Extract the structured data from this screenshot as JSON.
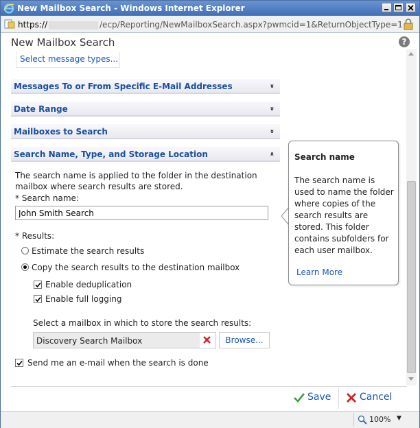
{
  "window": {
    "title": "New Mailbox Search - Windows Internet Explorer"
  },
  "address": {
    "protocol": "https://",
    "path": "/ecp/Reporting/NewMailboxSearch.aspx?pwmcid=1&ReturnObjectType=1"
  },
  "page": {
    "title": "New Mailbox Search",
    "help_icon": "?",
    "select_message_types": "Select message types..."
  },
  "sections": [
    {
      "label": "Messages To or From Specific E-Mail Addresses",
      "expanded": false
    },
    {
      "label": "Date Range",
      "expanded": false
    },
    {
      "label": "Mailboxes to Search",
      "expanded": false
    },
    {
      "label": "Search Name, Type, and Storage Location",
      "expanded": true
    }
  ],
  "chevrons": {
    "down": "»",
    "up": "«"
  },
  "search_section": {
    "description": "The search name is applied to the folder in the destination mailbox where search results are stored.",
    "search_name_label": "* Search name:",
    "search_name_value": "John Smith Search",
    "results_label": "* Results:",
    "estimate_label": "Estimate the search results",
    "copy_label": "Copy the search results to the destination mailbox",
    "dedup_label": "Enable deduplication",
    "logging_label": "Enable full logging",
    "select_mailbox_label": "Select a mailbox in which to store the search results:",
    "mailbox_value": "Discovery Search Mailbox",
    "browse_label": "Browse...",
    "email_label": "Send me an e-mail when the search is done"
  },
  "states": {
    "estimate_selected": false,
    "copy_selected": true,
    "dedup_checked": true,
    "logging_checked": true,
    "email_checked": true
  },
  "callout": {
    "title": "Search name",
    "body": "The search name is used to name the folder where copies of the search results are stored. This folder contains subfolders for each user mailbox.",
    "link": "Learn More"
  },
  "footer": {
    "save_label": "Save",
    "cancel_label": "Cancel"
  },
  "status": {
    "zoom": "100%",
    "zoom_arrow": "▼"
  },
  "icons": {
    "ie": "internet-explorer-icon",
    "page": "page-icon",
    "lock": "lock-icon",
    "help": "help-icon",
    "save": "checkmark-icon",
    "cancel": "x-icon",
    "clear": "clear-x-icon",
    "zoom": "magnifier-icon"
  },
  "colors": {
    "link": "#1a56b8",
    "section_header": "#1a4f9e",
    "save_check": "#3aa13a",
    "cancel_x": "#d22020"
  }
}
